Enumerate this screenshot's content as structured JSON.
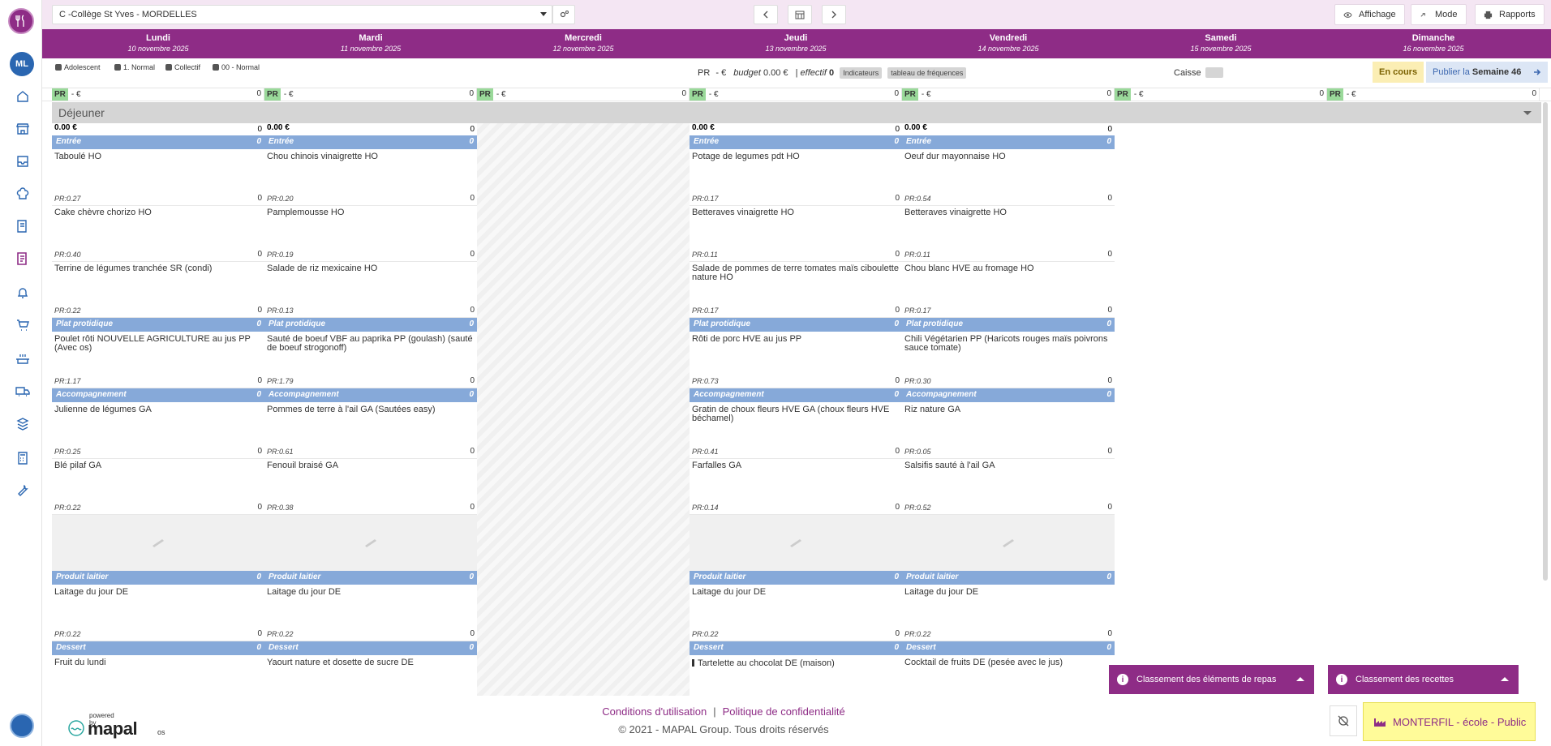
{
  "topbar": {
    "site": "C -Collège St Yves - MORDELLES",
    "affichage": "Affichage",
    "mode": "Mode",
    "rapports": "Rapports"
  },
  "user": {
    "initials": "ML"
  },
  "days": [
    {
      "name": "Lundi",
      "date": "10 novembre 2025"
    },
    {
      "name": "Mardi",
      "date": "11 novembre 2025"
    },
    {
      "name": "Mercredi",
      "date": "12 novembre 2025"
    },
    {
      "name": "Jeudi",
      "date": "13 novembre 2025"
    },
    {
      "name": "Vendredi",
      "date": "14 novembre 2025"
    },
    {
      "name": "Samedi",
      "date": "15 novembre 2025"
    },
    {
      "name": "Dimanche",
      "date": "16 novembre 2025"
    }
  ],
  "infobar": {
    "chips": [
      "Adolescent",
      "1. Normal",
      "Collectif",
      "00 - Normal"
    ],
    "pr_label": "PR",
    "pr_value": "- €",
    "budget_label": "budget",
    "budget_value": "0.00 €",
    "effectif_label": "effectif",
    "effectif_value": "0",
    "indicateurs": "Indicateurs",
    "frequences": "tableau de fréquences",
    "caisse": "Caisse",
    "status": "En cours",
    "publier": "Publier la",
    "week": "Semaine 46"
  },
  "prrow": {
    "pr": "PR",
    "eur": "- €",
    "count": "0"
  },
  "meal": "Déjeuner",
  "columns": [
    {
      "total": "0.00 €",
      "total_n": "0",
      "sections": [
        {
          "cat": "Entrée",
          "n": "0",
          "dishes": [
            {
              "name": "Taboulé HO",
              "pr": "PR:0.27",
              "n": "0"
            },
            {
              "name": "Cake chèvre chorizo HO",
              "pr": "PR:0.40",
              "n": "0"
            },
            {
              "name": "Terrine de légumes tranchée SR (condi)",
              "pr": "PR:0.22",
              "n": "0"
            }
          ]
        },
        {
          "cat": "Plat protidique",
          "n": "0",
          "dishes": [
            {
              "name": "Poulet rôti NOUVELLE AGRICULTURE au jus PP (Avec os)",
              "pr": "PR:1.17",
              "n": "0"
            }
          ]
        },
        {
          "cat": "Accompagnement",
          "n": "0",
          "dishes": [
            {
              "name": "Julienne de légumes GA",
              "pr": "PR:0.25",
              "n": "0"
            },
            {
              "name": "Blé pilaf GA",
              "pr": "PR:0.22",
              "n": "0"
            },
            {
              "placeholder": true
            }
          ]
        },
        {
          "cat": "Produit laitier",
          "n": "0",
          "dishes": [
            {
              "name": "Laitage du jour DE",
              "pr": "PR:0.22",
              "n": "0"
            }
          ]
        },
        {
          "cat": "Dessert",
          "n": "0",
          "dishes": [
            {
              "name": "Fruit du lundi",
              "pr": "",
              "n": ""
            }
          ]
        }
      ]
    },
    {
      "total": "0.00 €",
      "total_n": "0",
      "sections": [
        {
          "cat": "Entrée",
          "n": "0",
          "dishes": [
            {
              "name": "Chou chinois vinaigrette HO",
              "pr": "PR:0.20",
              "n": "0"
            },
            {
              "name": "Pamplemousse HO",
              "pr": "PR:0.19",
              "n": "0"
            },
            {
              "name": "Salade de riz mexicaine HO",
              "pr": "PR:0.13",
              "n": "0"
            }
          ]
        },
        {
          "cat": "Plat protidique",
          "n": "0",
          "dishes": [
            {
              "name": "Sauté de boeuf VBF au paprika PP (goulash) (sauté de boeuf strogonoff)",
              "pr": "PR:1.79",
              "n": "0"
            }
          ]
        },
        {
          "cat": "Accompagnement",
          "n": "0",
          "dishes": [
            {
              "name": "Pommes de terre à l'ail GA (Sautées easy)",
              "pr": "PR:0.61",
              "n": "0"
            },
            {
              "name": "Fenouil braisé GA",
              "pr": "PR:0.38",
              "n": "0"
            },
            {
              "placeholder": true
            }
          ]
        },
        {
          "cat": "Produit laitier",
          "n": "0",
          "dishes": [
            {
              "name": "Laitage du jour DE",
              "pr": "PR:0.22",
              "n": "0"
            }
          ]
        },
        {
          "cat": "Dessert",
          "n": "0",
          "dishes": [
            {
              "name": "Yaourt nature et dosette de sucre DE",
              "pr": "",
              "n": ""
            }
          ]
        }
      ]
    },
    {
      "empty": true
    },
    {
      "total": "0.00 €",
      "total_n": "0",
      "sections": [
        {
          "cat": "Entrée",
          "n": "0",
          "dishes": [
            {
              "name": "Potage de legumes pdt HO",
              "pr": "PR:0.17",
              "n": "0"
            },
            {
              "name": "Betteraves vinaigrette HO",
              "pr": "PR:0.11",
              "n": "0"
            },
            {
              "name": "Salade de pommes de terre tomates maïs ciboulette nature HO",
              "pr": "PR:0.17",
              "n": "0"
            }
          ]
        },
        {
          "cat": "Plat protidique",
          "n": "0",
          "dishes": [
            {
              "name": "Rôti de porc HVE au jus PP",
              "pr": "PR:0.73",
              "n": "0"
            }
          ]
        },
        {
          "cat": "Accompagnement",
          "n": "0",
          "dishes": [
            {
              "name": "Gratin de choux fleurs HVE GA (choux fleurs HVE béchamel)",
              "pr": "PR:0.41",
              "n": "0"
            },
            {
              "name": "Farfalles GA",
              "pr": "PR:0.14",
              "n": "0"
            },
            {
              "placeholder": true
            }
          ]
        },
        {
          "cat": "Produit laitier",
          "n": "0",
          "dishes": [
            {
              "name": "Laitage du jour DE",
              "pr": "PR:0.22",
              "n": "0"
            }
          ]
        },
        {
          "cat": "Dessert",
          "n": "0",
          "dishes": [
            {
              "name": "Tartelette au chocolat DE (maison)",
              "pr": "",
              "n": "",
              "warn": true
            }
          ]
        }
      ]
    },
    {
      "total": "0.00 €",
      "total_n": "0",
      "sections": [
        {
          "cat": "Entrée",
          "n": "0",
          "dishes": [
            {
              "name": "Oeuf dur mayonnaise HO",
              "pr": "PR:0.54",
              "n": "0"
            },
            {
              "name": "Betteraves vinaigrette HO",
              "pr": "PR:0.11",
              "n": "0"
            },
            {
              "name": "Chou blanc HVE au fromage HO",
              "pr": "PR:0.17",
              "n": "0"
            }
          ]
        },
        {
          "cat": "Plat protidique",
          "n": "0",
          "dishes": [
            {
              "name": "Chili Végétarien PP (Haricots rouges maïs poivrons sauce tomate)",
              "pr": "PR:0.30",
              "n": "0"
            }
          ]
        },
        {
          "cat": "Accompagnement",
          "n": "0",
          "dishes": [
            {
              "name": "Riz nature GA",
              "pr": "PR:0.05",
              "n": "0"
            },
            {
              "name": "Salsifis sauté à l'ail GA",
              "pr": "PR:0.52",
              "n": "0"
            },
            {
              "placeholder": true
            }
          ]
        },
        {
          "cat": "Produit laitier",
          "n": "0",
          "dishes": [
            {
              "name": "Laitage du jour DE",
              "pr": "PR:0.22",
              "n": "0"
            }
          ]
        },
        {
          "cat": "Dessert",
          "n": "0",
          "dishes": [
            {
              "name": "Cocktail de fruits DE (pesée avec le jus)",
              "pr": "",
              "n": ""
            }
          ]
        }
      ]
    }
  ],
  "panels": {
    "repas": "Classement des éléments de repas",
    "recettes": "Classement des recettes"
  },
  "footer": {
    "powered": "powered by",
    "brand": "mapal",
    "os": "os",
    "cgu": "Conditions d'utilisation",
    "sep": "|",
    "privacy": "Politique de confidentialité",
    "copyright": "© 2021 - MAPAL Group. Tous droits réservés",
    "site_label": "MONTERFIL - école - Public"
  },
  "colors": {
    "brand": "#8e2c86",
    "category": "#86a9d9",
    "pr_badge": "#9ad99a",
    "highlight": "#fffb99"
  }
}
